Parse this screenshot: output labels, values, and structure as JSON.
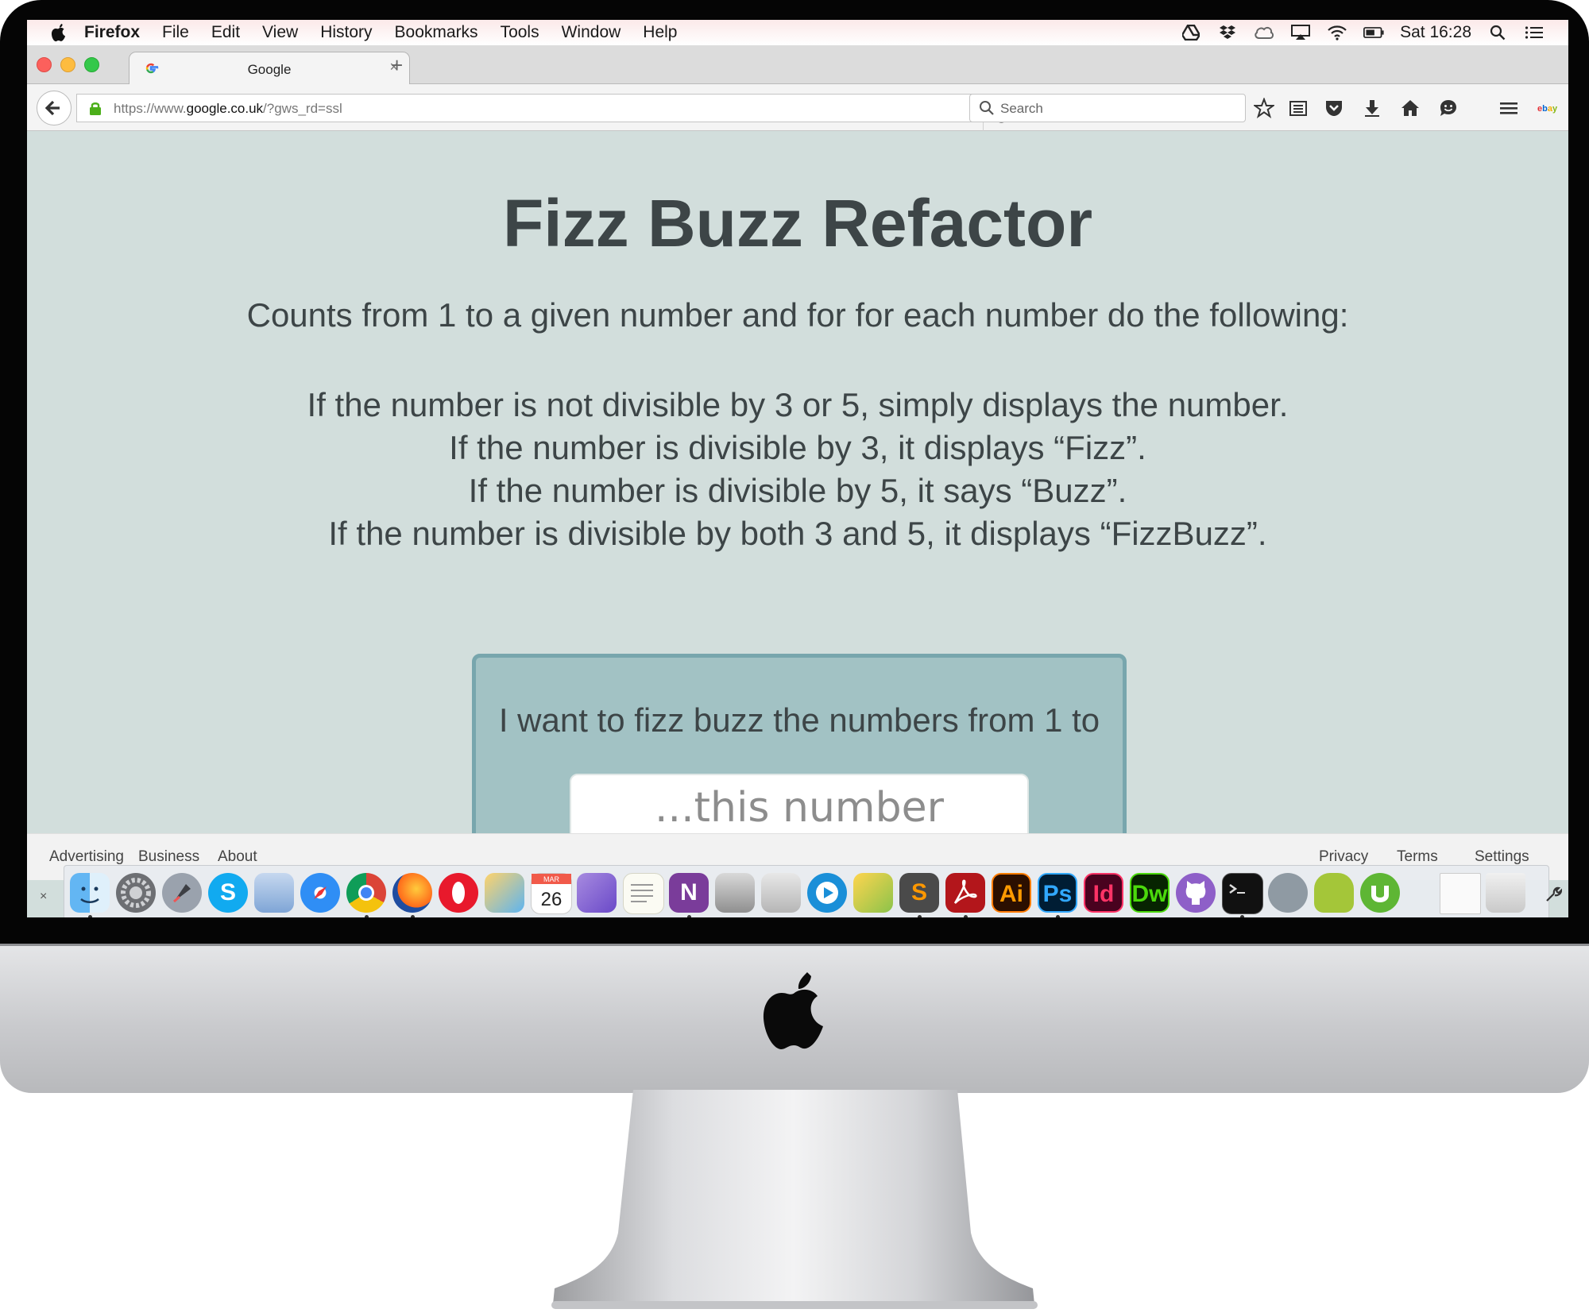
{
  "menubar": {
    "app_name": "Firefox",
    "items": [
      "File",
      "Edit",
      "View",
      "History",
      "Bookmarks",
      "Tools",
      "Window",
      "Help"
    ],
    "clock": "Sat 16:28"
  },
  "browser": {
    "tab_title": "Google",
    "url_prefix": "https://www.",
    "url_domain": "google.co.uk",
    "url_suffix": "/?gws_rd=ssl",
    "search_placeholder": "Search"
  },
  "page": {
    "title": "Fizz Buzz Refactor",
    "intro": "Counts from 1 to a given number and for for each number do the following:",
    "rules": [
      "If the number is not divisible by 3 or 5, simply displays the number.",
      "If the number is divisible by 3, it displays “Fizz”.",
      "If the number is divisible by 5, it says “Buzz”.",
      "If the number is divisible by both 3 and 5, it displays “FizzBuzz”."
    ],
    "card_label": "I want to fizz buzz the numbers from 1 to",
    "number_placeholder": "...this number",
    "number_value": ""
  },
  "google_footer": {
    "left": [
      "Advertising",
      "Business",
      "About"
    ],
    "right": [
      "Privacy",
      "Terms",
      "Settings"
    ]
  },
  "dock": {
    "calendar_month": "MAR",
    "calendar_day": "26",
    "labels": {
      "illustrator": "Ai",
      "photoshop": "Ps",
      "indesign": "Id",
      "dreamweaver": "Dw",
      "sublime": "S",
      "onenote": "N",
      "skype": "S"
    }
  },
  "colors": {
    "page_background": "#d2dedc",
    "text": "#3d4547",
    "card_background": "#a2c2c4",
    "card_border": "#78a6ad"
  }
}
